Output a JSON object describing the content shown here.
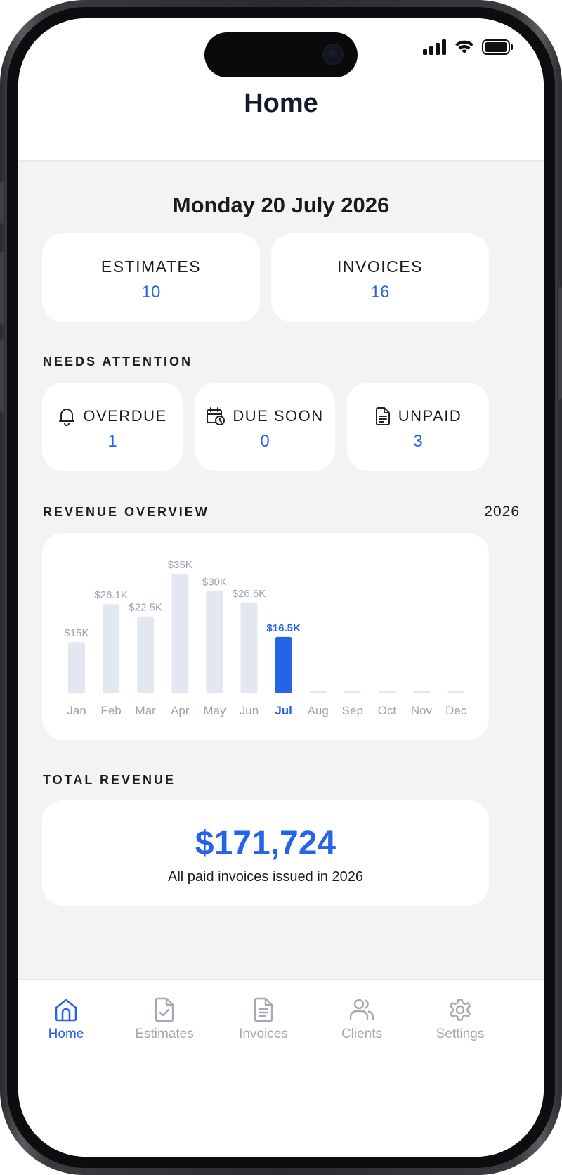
{
  "header": {
    "title": "Home"
  },
  "date": "Monday 20 July 2026",
  "summary": {
    "estimates": {
      "label": "ESTIMATES",
      "value": "10"
    },
    "invoices": {
      "label": "INVOICES",
      "value": "16"
    }
  },
  "needs_attention": {
    "label": "NEEDS ATTENTION",
    "items": [
      {
        "label": "OVERDUE",
        "value": "1",
        "icon": "bell-icon"
      },
      {
        "label": "DUE SOON",
        "value": "0",
        "icon": "calendar-clock-icon"
      },
      {
        "label": "UNPAID",
        "value": "3",
        "icon": "document-icon"
      }
    ]
  },
  "revenue_overview": {
    "label": "REVENUE OVERVIEW",
    "year": "2026"
  },
  "chart_data": {
    "type": "bar",
    "categories": [
      "Jan",
      "Feb",
      "Mar",
      "Apr",
      "May",
      "Jun",
      "Jul",
      "Aug",
      "Sep",
      "Oct",
      "Nov",
      "Dec"
    ],
    "values": [
      15,
      26.1,
      22.5,
      35,
      30,
      26.6,
      16.5,
      0,
      0,
      0,
      0,
      0
    ],
    "value_labels": [
      "$15K",
      "$26.1K",
      "$22.5K",
      "$35K",
      "$30K",
      "$26.6K",
      "$16.5K",
      "",
      "",
      "",
      "",
      ""
    ],
    "highlight_index": 6,
    "unit": "$K",
    "ylim": [
      0,
      35
    ],
    "grid": false,
    "colors": {
      "default": "#e3e8f0",
      "highlight": "#2563eb",
      "label": "#9aa3b2",
      "highlight_label": "#2563eb"
    }
  },
  "total_revenue": {
    "label": "TOTAL REVENUE",
    "amount": "$171,724",
    "subtitle": "All paid invoices issued in 2026"
  },
  "tabbar": {
    "tabs": [
      {
        "label": "Home",
        "icon": "home-icon",
        "active": true
      },
      {
        "label": "Estimates",
        "icon": "estimate-document-icon",
        "active": false
      },
      {
        "label": "Invoices",
        "icon": "invoice-document-icon",
        "active": false
      },
      {
        "label": "Clients",
        "icon": "users-icon",
        "active": false
      },
      {
        "label": "Settings",
        "icon": "gear-icon",
        "active": false
      }
    ]
  },
  "colors": {
    "accent": "#2563eb",
    "background": "#f2f3f5",
    "card": "#ffffff",
    "text": "#1b1b1b"
  }
}
